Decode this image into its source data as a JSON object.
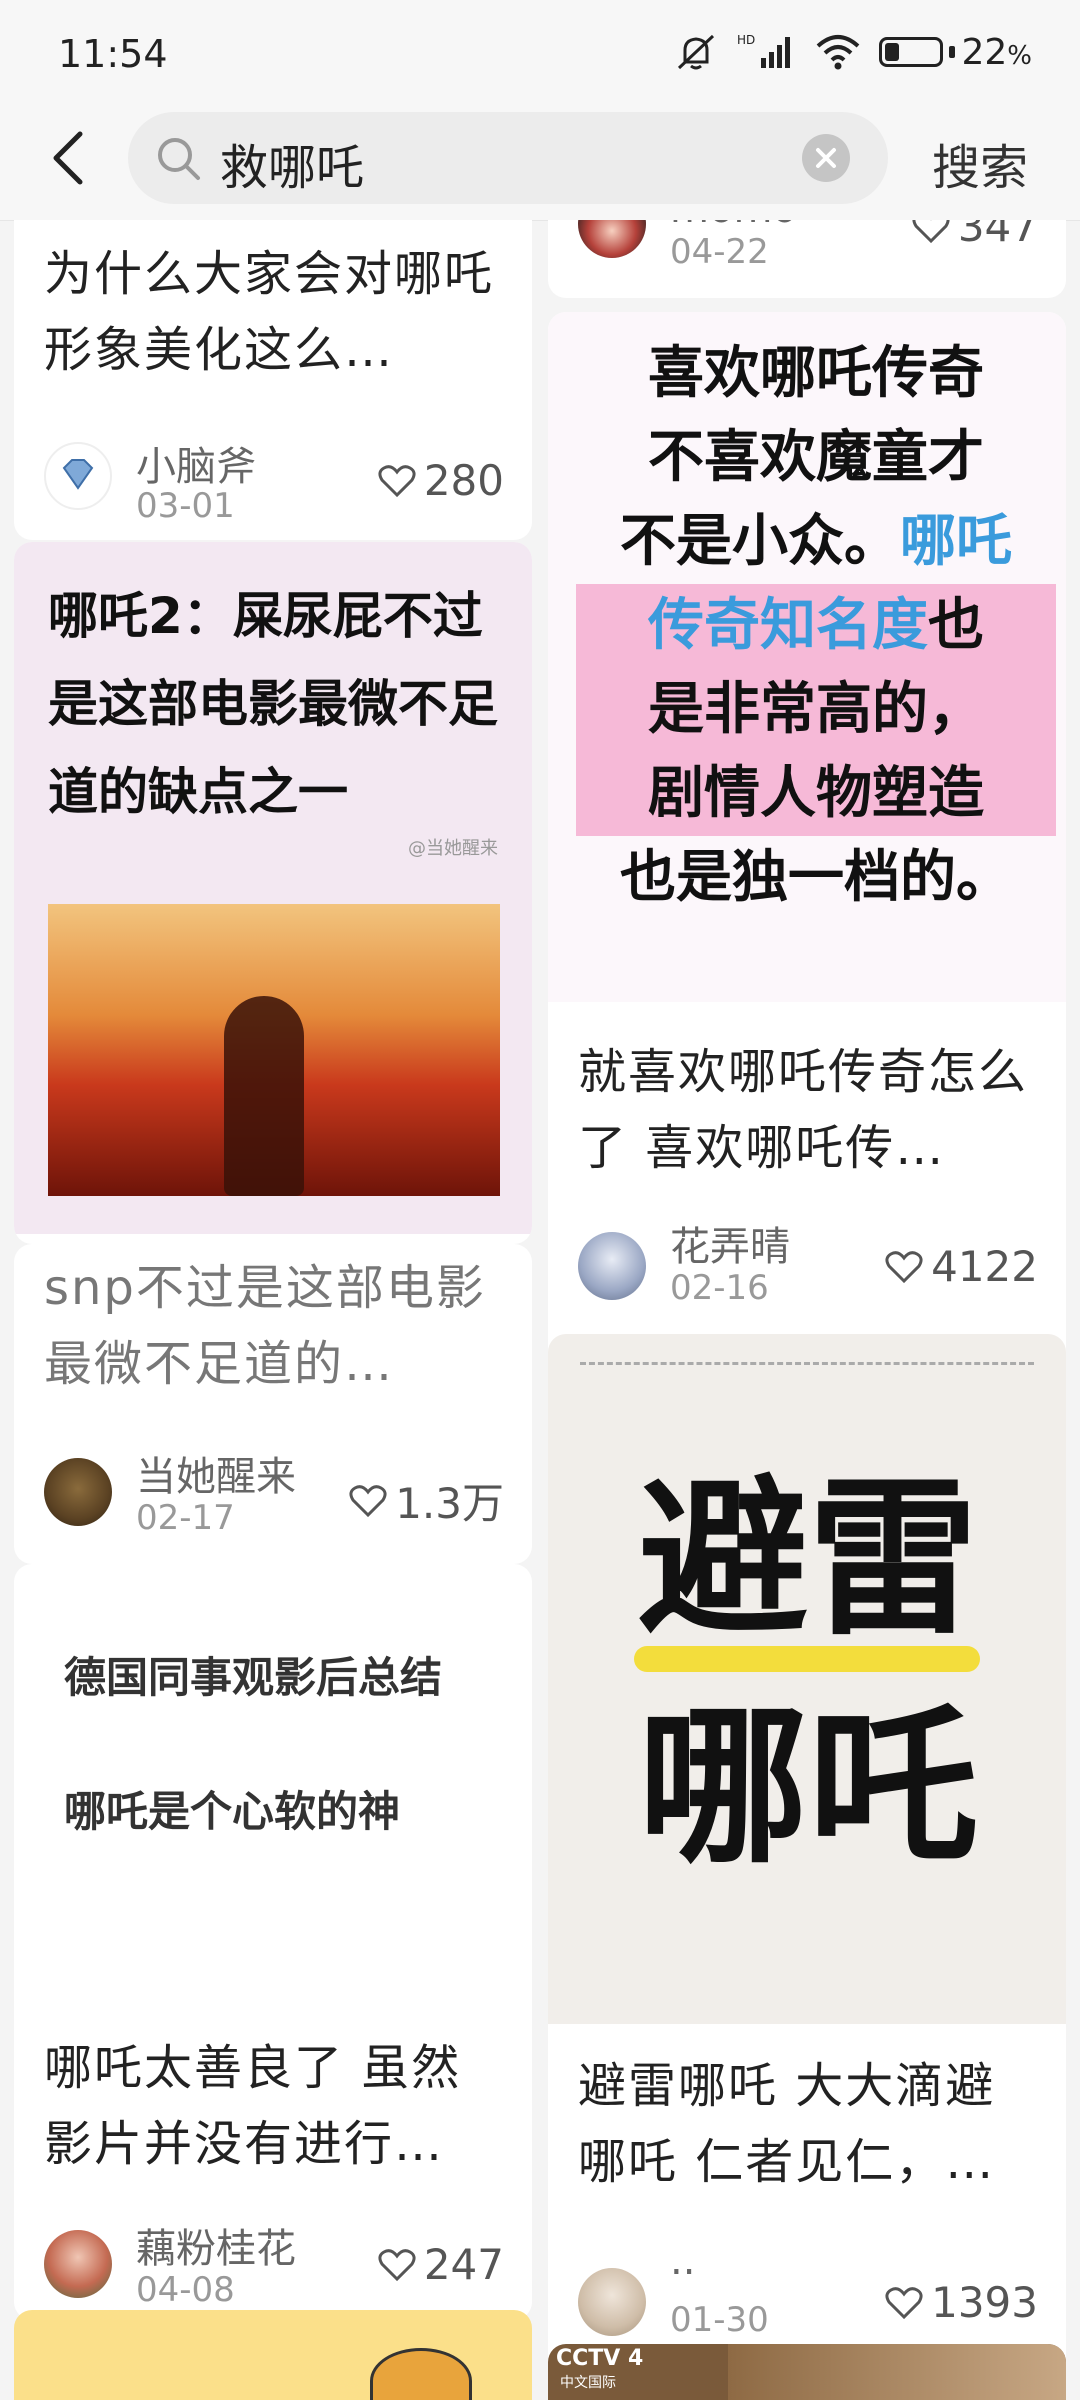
{
  "status": {
    "time": "11:54",
    "battery": "22",
    "battery_unit": "%",
    "network": "HD"
  },
  "search": {
    "query": "救哪吒",
    "button": "搜索"
  },
  "left": [
    {
      "title": "为什么大家会对哪吒形象美化这么…",
      "user": "小脑斧",
      "date": "03-01",
      "likes": "280"
    },
    {
      "image_text": "哪吒2：屎尿屁不过是这部电影最微不足道的缺点之一",
      "watermark": "@当她醒来",
      "title": "snp不过是这部电影最微不足道的…",
      "user": "当她醒来",
      "date": "02-17",
      "likes": "1.3万"
    },
    {
      "lines": [
        "德国同事观影后总结",
        "哪吒是个心软的神"
      ],
      "title": "哪吒太善良了 虽然影片并没有进行…",
      "user": "藕粉桂花",
      "date": "04-08",
      "likes": "247"
    }
  ],
  "right": [
    {
      "user": "momo",
      "date": "04-22",
      "likes": "347"
    },
    {
      "image_text": {
        "l1": "喜欢哪吒传奇",
        "l2": "不喜欢魔童才",
        "l3a": "不是小众。",
        "l3b": "哪吒",
        "l4a": "传奇知名度",
        "l4b": "也",
        "l5": "是非常高的，",
        "l6": "剧情人物塑造",
        "l7": "也是独一档的。"
      },
      "title": "就喜欢哪吒传奇怎么了 喜欢哪吒传…",
      "user": "花弄晴",
      "date": "02-16",
      "likes": "4122"
    },
    {
      "image_text": {
        "l1": "避雷",
        "l2": "哪吒"
      },
      "title": "避雷哪吒 大大滴避哪吒 仁者见仁，…",
      "user": "..",
      "date": "01-30",
      "likes": "1393"
    },
    {
      "tv_logo": "CCTV 4",
      "tv_sub": "中文国际"
    }
  ]
}
